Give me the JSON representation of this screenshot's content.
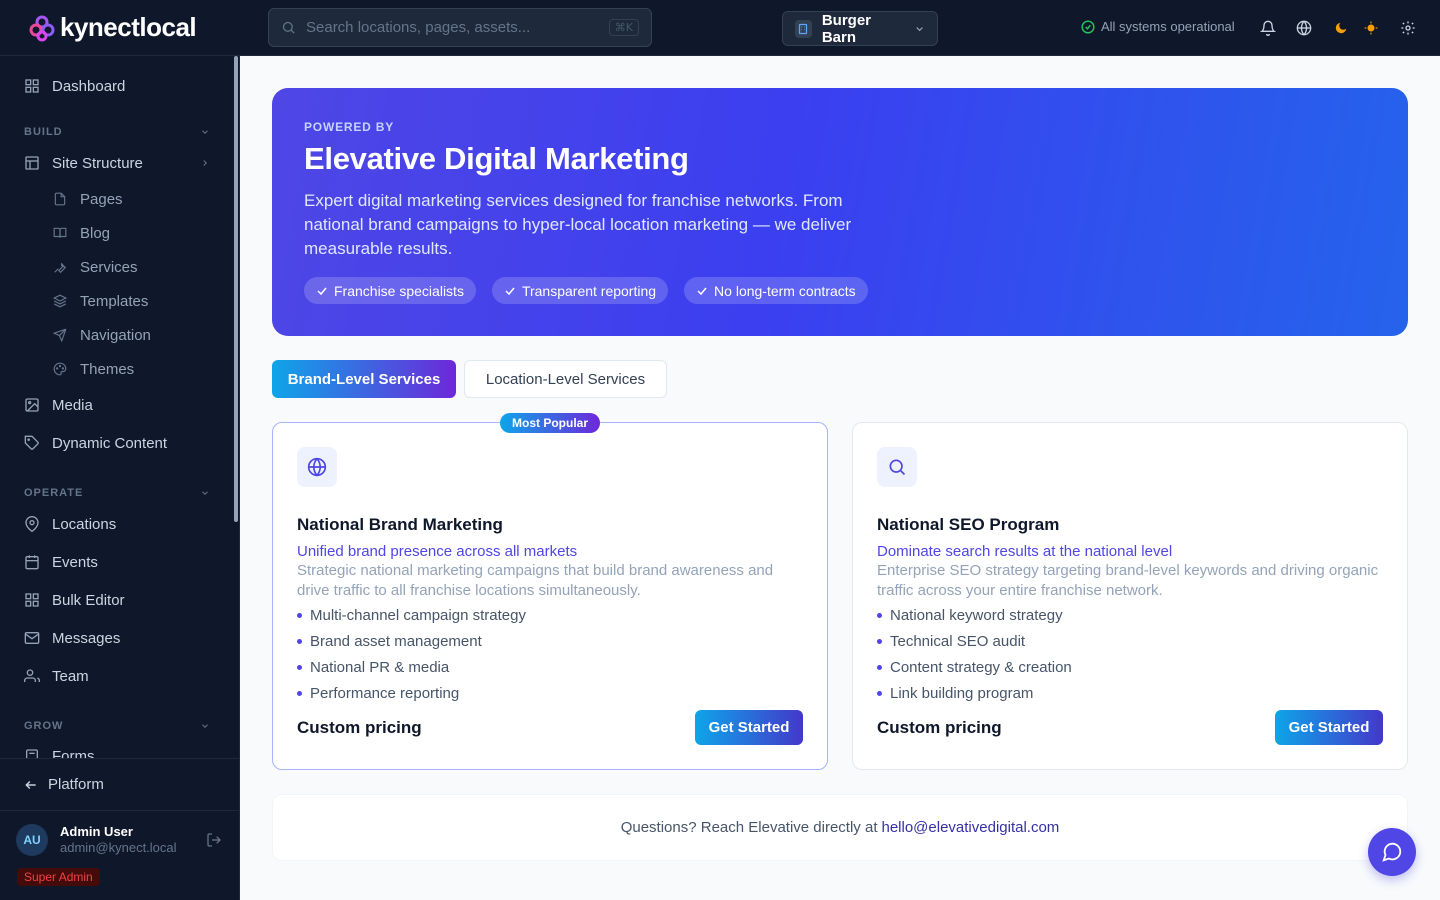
{
  "app": {
    "brand": "kynectlocal"
  },
  "search": {
    "placeholder": "Search locations, pages, assets...",
    "shortcut": "⌘K"
  },
  "location_switcher": {
    "label": "Burger Barn"
  },
  "status": {
    "text": "All systems operational",
    "color": "#22c55e"
  },
  "sidebar": {
    "dashboard": "Dashboard",
    "sections": {
      "build": "BUILD",
      "operate": "OPERATE",
      "grow": "GROW"
    },
    "build_items": {
      "site_structure": "Site Structure",
      "pages": "Pages",
      "blog": "Blog",
      "services": "Services",
      "templates": "Templates",
      "navigation": "Navigation",
      "themes": "Themes",
      "media": "Media",
      "dynamic_content": "Dynamic Content"
    },
    "operate_items": {
      "locations": "Locations",
      "events": "Events",
      "bulk_editor": "Bulk Editor",
      "messages": "Messages",
      "team": "Team"
    },
    "grow_items": {
      "forms": "Forms"
    },
    "platform": "Platform",
    "user": {
      "initials": "AU",
      "name": "Admin User",
      "email": "admin@kynect.local",
      "role": "Super Admin"
    }
  },
  "hero": {
    "eyebrow": "POWERED BY",
    "title": "Elevative Digital Marketing",
    "description": "Expert digital marketing services designed for franchise networks. From national brand campaigns to hyper-local location marketing — we deliver measurable results.",
    "chips": [
      "Franchise specialists",
      "Transparent reporting",
      "No long-term contracts"
    ]
  },
  "tabs": {
    "brand": "Brand-Level Services",
    "location": "Location-Level Services"
  },
  "cards": [
    {
      "badge": "Most Popular",
      "icon": "globe-icon",
      "title": "National Brand Marketing",
      "tagline": "Unified brand presence across all markets",
      "description": "Strategic national marketing campaigns that build brand awareness and drive traffic to all franchise locations simultaneously.",
      "features": [
        "Multi-channel campaign strategy",
        "Brand asset management",
        "National PR & media",
        "Performance reporting"
      ],
      "price": "Custom pricing",
      "cta": "Get Started"
    },
    {
      "icon": "search-icon",
      "title": "National SEO Program",
      "tagline": "Dominate search results at the national level",
      "description": "Enterprise SEO strategy targeting brand-level keywords and driving organic traffic across your entire franchise network.",
      "features": [
        "National keyword strategy",
        "Technical SEO audit",
        "Content strategy & creation",
        "Link building program"
      ],
      "price": "Custom pricing",
      "cta": "Get Started"
    }
  ],
  "contact": {
    "text": "Questions? Reach Elevative directly at",
    "email": "hello@elevativedigital.com"
  },
  "colors": {
    "accent": "#4f46e5",
    "sidebar_bg": "#0f172a",
    "hero_start": "#4f46e5",
    "hero_end": "#2563eb"
  }
}
